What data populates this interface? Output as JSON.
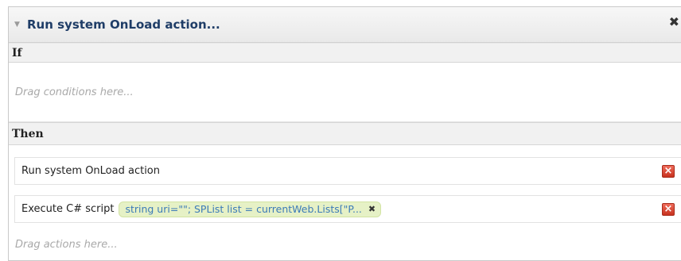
{
  "rule": {
    "title": "Run system OnLoad action...",
    "collapse_icon": "triangle-down-icon",
    "close_icon": "close-icon"
  },
  "if_section": {
    "label": "If",
    "placeholder": "Drag conditions here..."
  },
  "then_section": {
    "label": "Then",
    "placeholder": "Drag actions here...",
    "actions": [
      {
        "label": "Run system OnLoad action",
        "delete_icon": "delete-icon"
      },
      {
        "label": "Execute C# script",
        "parameter": "string uri=\"\"; SPList list = currentWeb.Lists[\"P...",
        "delete_icon": "delete-icon"
      }
    ]
  },
  "colors": {
    "title": "#1f3d67",
    "pill_background": "#e6f1c6",
    "pill_text": "#3c7bb8",
    "delete_button": "#d9412f"
  }
}
